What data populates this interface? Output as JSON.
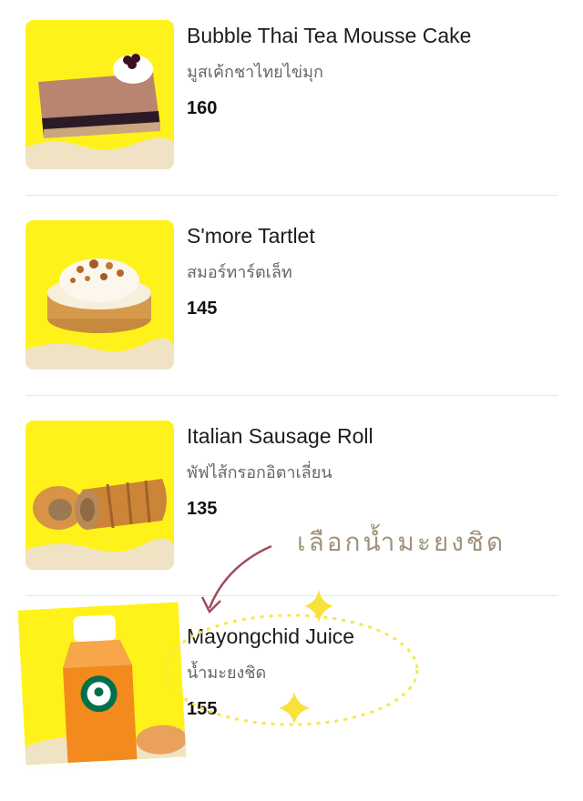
{
  "items": [
    {
      "name": "Bubble Thai Tea Mousse Cake",
      "subtitle": "มูสเค้กชาไทยไข่มุก",
      "price": "160"
    },
    {
      "name": "S'more Tartlet",
      "subtitle": "สมอร์ทาร์ตเล็ท",
      "price": "145"
    },
    {
      "name": "Italian Sausage Roll",
      "subtitle": "พัฟไส้กรอกอิตาเลี่ยน",
      "price": "135"
    },
    {
      "name": "Mayongchid Juice",
      "subtitle": "น้ำมะยงชิด",
      "price": "155"
    }
  ],
  "annotation": {
    "text": "เลือกน้ำมะยงชิด"
  },
  "colors": {
    "thumb_bg": "#fff21a",
    "sand": "#efe3c4",
    "star": "#f7e23a",
    "arrow": "#a34b5a",
    "annotation_text": "#a0937a"
  }
}
